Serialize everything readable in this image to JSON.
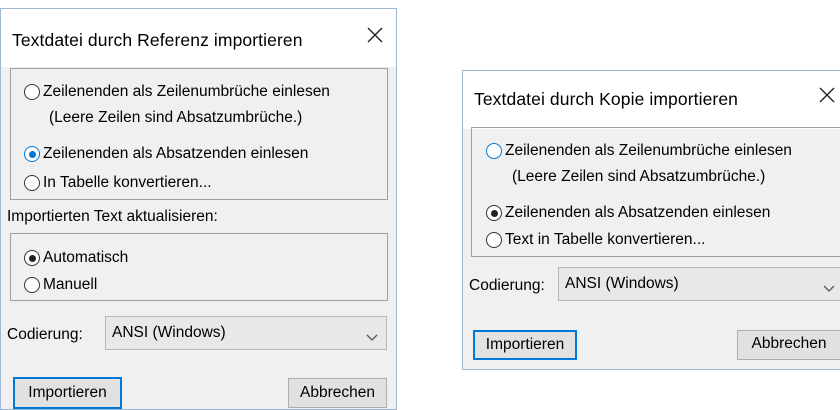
{
  "dialog_reference": {
    "title": "Textdatei durch Referenz importieren",
    "options": [
      {
        "label": "Zeilenenden als Zeilenumbrüche einlesen",
        "checked": false
      },
      {
        "label": "(Leere Zeilen sind Absatzumbrüche.)"
      },
      {
        "label": "Zeilenenden als Absatzenden einlesen",
        "checked": true
      },
      {
        "label": "In Tabelle konvertieren...",
        "checked": false
      }
    ],
    "update_label": "Importierten Text aktualisieren:",
    "update_options": [
      {
        "label": "Automatisch",
        "checked": true
      },
      {
        "label": "Manuell",
        "checked": false
      }
    ],
    "encoding_label": "Codierung:",
    "encoding_value": "ANSI (Windows)",
    "import_button": "Importieren",
    "cancel_button": "Abbrechen"
  },
  "dialog_copy": {
    "title": "Textdatei durch Kopie importieren",
    "options": [
      {
        "label": "Zeilenenden als Zeilenumbrüche einlesen",
        "checked": false
      },
      {
        "label": "(Leere Zeilen sind Absatzumbrüche.)"
      },
      {
        "label": "Zeilenenden als Absatzenden einlesen",
        "checked": true
      },
      {
        "label": "Text in Tabelle konvertieren...",
        "checked": false
      }
    ],
    "encoding_label": "Codierung:",
    "encoding_value": "ANSI (Windows)",
    "import_button": "Importieren",
    "cancel_button": "Abbrechen"
  },
  "colors": {
    "accent": "#0078d7",
    "dialog_bg": "#f0f0f0",
    "button_bg": "#e1e1e1"
  },
  "icons": [
    "close-icon",
    "chevron-down-icon"
  ]
}
